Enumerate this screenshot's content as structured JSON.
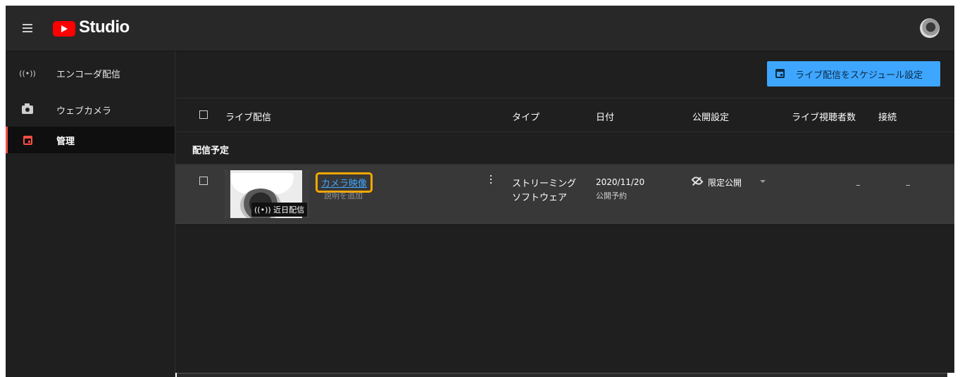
{
  "app": {
    "logo_text": "Studio",
    "accent_color": "#ff0000",
    "link_color": "#3ea6ff",
    "highlight_color": "#f6a800"
  },
  "sidebar": {
    "items": [
      {
        "label": "エンコーダ配信",
        "icon": "broadcast-icon",
        "glyph": "((•))"
      },
      {
        "label": "ウェブカメラ",
        "icon": "camera-icon"
      },
      {
        "label": "管理",
        "icon": "calendar-icon",
        "active": true
      }
    ]
  },
  "toolbar": {
    "schedule_label": "ライブ配信をスケジュール設定"
  },
  "table": {
    "headers": {
      "stream": "ライブ配信",
      "type": "タイプ",
      "date": "日付",
      "visibility": "公開設定",
      "viewers": "ライブ視聴者数",
      "connection": "接続"
    },
    "section_label": "配信予定",
    "rows": [
      {
        "title": "カメラ映像",
        "description_placeholder": "説明を追加",
        "thumbnail_badge": "((•)) 近日配信",
        "type_line1": "ストリーミング",
        "type_line2": "ソフトウェア",
        "date": "2020/11/20",
        "date_status": "公開予約",
        "visibility": "限定公開",
        "viewers": "–",
        "connection": "–"
      }
    ]
  }
}
